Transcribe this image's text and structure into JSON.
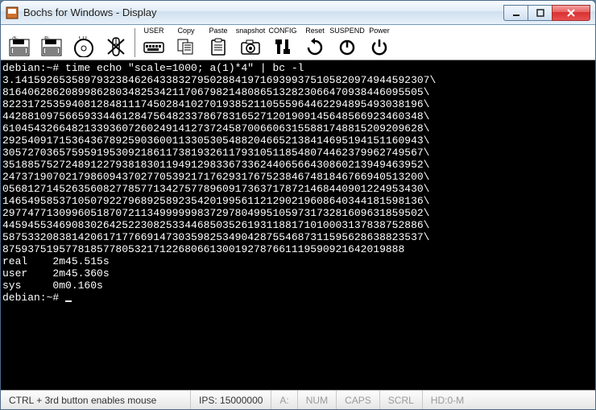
{
  "window": {
    "title": "Bochs for Windows - Display"
  },
  "toolbar": {
    "items": [
      {
        "label": "",
        "name": "floppy-a-icon"
      },
      {
        "label": "",
        "name": "floppy-b-icon"
      },
      {
        "label": "",
        "name": "cdrom-icon"
      },
      {
        "label": "",
        "name": "mouse-icon"
      },
      {
        "label": "USER",
        "name": "user-icon"
      },
      {
        "label": "Copy",
        "name": "copy-icon"
      },
      {
        "label": "Paste",
        "name": "paste-icon"
      },
      {
        "label": "snapshot",
        "name": "snapshot-icon"
      },
      {
        "label": "CONFIG",
        "name": "config-icon"
      },
      {
        "label": "Reset",
        "name": "reset-icon"
      },
      {
        "label": "SUSPEND",
        "name": "suspend-icon"
      },
      {
        "label": "Power",
        "name": "power-icon"
      }
    ]
  },
  "terminal": {
    "lines": [
      "debian:~# time echo \"scale=1000; a(1)*4\" | bc -l",
      "3.141592653589793238462643383279502884197169399375105820974944592307\\",
      "8164062862089986280348253421170679821480865132823066470938446095505\\",
      "8223172535940812848111745028410270193852110555964462294895493038196\\",
      "4428810975665933446128475648233786783165271201909145648566923460348\\",
      "6104543266482133936072602491412737245870066063155881748815209209628\\",
      "2925409171536436789259036001133053054882046652138414695194151160943\\",
      "3057270365759591953092186117381932611793105118548074462379962749567\\",
      "3518857527248912279381830119491298336733624406566430860213949463952\\",
      "2473719070217986094370277053921717629317675238467481846766940513200\\",
      "0568127145263560827785771342757789609173637178721468440901224953430\\",
      "1465495853710507922796892589235420199561121290219608640344181598136\\",
      "2977477130996051870721134999999837297804995105973173281609631859502\\",
      "4459455346908302642522308253344685035261931188171010003137838752886\\",
      "5875332083814206171776691473035982534904287554687311595628638823537\\",
      "8759375195778185778053217122680661300192787661119590921642019888",
      "",
      "real    2m45.515s",
      "user    2m45.360s",
      "sys     0m0.160s"
    ],
    "prompt": "debian:~# "
  },
  "statusbar": {
    "hint": "CTRL + 3rd button enables mouse",
    "ips_label": "IPS:",
    "ips_value": "15000000",
    "drive_a": "A:",
    "num": "NUM",
    "caps": "CAPS",
    "scrl": "SCRL",
    "hd": "HD:0-M"
  }
}
